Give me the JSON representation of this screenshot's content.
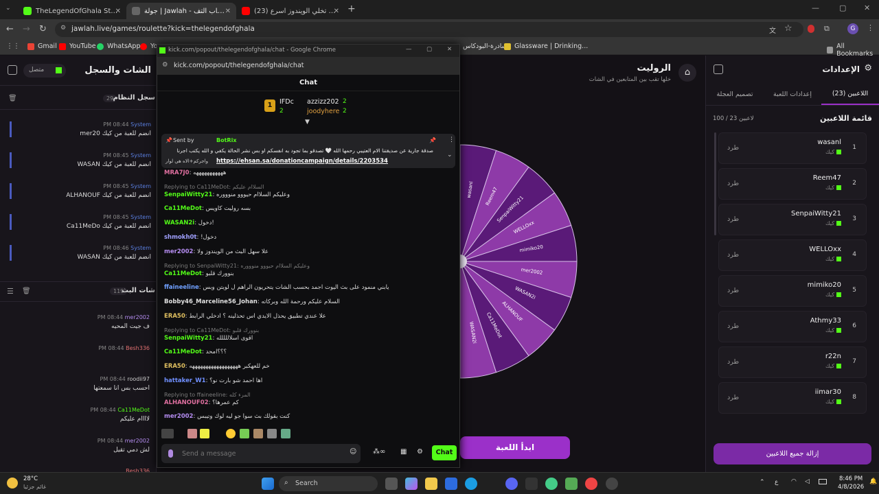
{
  "tabs": [
    {
      "title": "TheLegendOfGhala Stream - Ki",
      "active": false,
      "color": "#53fc18"
    },
    {
      "title": "جولة | Jawlah - منصة الألعاب التف",
      "active": true,
      "color": "#2b2b2b"
    },
    {
      "title": "(23) كيف تخلي الويندوز اسرع - YouTube",
      "active": false,
      "color": "#ff0000"
    }
  ],
  "address": {
    "url": "jawlah.live/games/roulette?kick=thelegendofghala"
  },
  "bookmarks": {
    "items": [
      "Gmail",
      "YouTube",
      "WhatsApp",
      "Yo",
      "سادرة-البودكاس",
      "Glassware | Drinking..."
    ],
    "all": "All Bookmarks"
  },
  "left_panel": {
    "title": "الشات والسجل",
    "status": "متصل",
    "log_title": "سجل النظام",
    "log_count": "29",
    "logs": [
      {
        "time": "PM 08:44",
        "who": "System",
        "msg": "mer20 انضم للعبة من كيك"
      },
      {
        "time": "PM 08:45",
        "who": "System",
        "msg": "WASAN انضم للعبة من كيك"
      },
      {
        "time": "PM 08:45",
        "who": "System",
        "msg": "ALHANOUF انضم للعبة من كيك"
      },
      {
        "time": "PM 08:45",
        "who": "System",
        "msg": "Ca11MeDo انضم للعبة من كيك"
      },
      {
        "time": "PM 08:46",
        "who": "System",
        "msg": "WASAN انضم للعبة من كيك"
      }
    ],
    "chat_title": "شات البث",
    "chat_count": "119",
    "chat": [
      {
        "time": "PM 08:44",
        "who": "mer2002",
        "color": "#b48cf0",
        "msg": "ف جيت المحيه"
      },
      {
        "time": "PM 08:44",
        "who": "Besh336",
        "color": "#e07070",
        "msg": ""
      },
      {
        "time": "PM 08:44",
        "who": "roodii97",
        "color": "#cccccc",
        "msg": "احسب بس انا سمعتها"
      },
      {
        "time": "PM 08:44",
        "who": "Ca11MeDot",
        "color": "#53fc18",
        "msg": "لاااام عليكم"
      },
      {
        "time": "PM 08:44",
        "who": "mer2002",
        "color": "#b48cf0",
        "msg": "لش دمي تقيل"
      },
      {
        "time": "",
        "who": "Besh336",
        "color": "#e07070",
        "msg": ""
      }
    ]
  },
  "game": {
    "title": "الروليت",
    "subtitle": "خلها تقب بين المتابعين في الشات",
    "start_label": "ابدأ اللعبة"
  },
  "wheel": {
    "slices": [
      "wasanl",
      "Reem47",
      "SenpaiWitty21",
      "WELLOxx",
      "mimiko20",
      "mer2002",
      "WASAN2i",
      "ALHANOUF",
      "Ca11MeDot",
      "WASAN2i"
    ]
  },
  "settings": {
    "title": "الإعدادات",
    "tabs": [
      "اللاعبين (23)",
      "إعدادات اللعبة",
      "تصميم العجلة"
    ],
    "list_title": "قائمة اللاعبين",
    "capacity": "100 / 23 لاعبين",
    "platform": "كيك",
    "kick_label": "طرد",
    "players": [
      {
        "n": "1",
        "name": "wasanl"
      },
      {
        "n": "2",
        "name": "Reem47"
      },
      {
        "n": "3",
        "name": "SenpaiWitty21"
      },
      {
        "n": "4",
        "name": "WELLOxx"
      },
      {
        "n": "5",
        "name": "mimiko20"
      },
      {
        "n": "6",
        "name": "Athmy33"
      },
      {
        "n": "7",
        "name": "r22n"
      },
      {
        "n": "8",
        "name": "iimar30"
      }
    ],
    "remove_all": "إزالة جميع اللاعبين"
  },
  "popup": {
    "window_title": "kick.com/popout/thelegendofghala/chat - Google Chrome",
    "url": "kick.com/popout/thelegendofghala/chat",
    "header": "Chat",
    "gift_top": {
      "user1": "azzizz202",
      "user2": "joodyhere",
      "n1": "2",
      "n2": "2",
      "me": "IFDc",
      "me_n": "2"
    },
    "pinned": {
      "sent_by": "Sent by",
      "bot": "BotRix",
      "text1": "صدقة جارية عن صديقتنا الام العتيبي رحمها الله 🤍 تصدقو بما تجود به انفسكم او بس نشر الحالة يكفي و الله يكتب اجرنا",
      "text2": "واجركم+الاه هي لوار",
      "link": "https://ehsan.sa/donationcampaign/details/2203534"
    },
    "messages": [
      {
        "u": "MRA7J0",
        "c": "#e070a0",
        "t": "هههههههههههه",
        "r": ""
      },
      {
        "u": "SenpaiWitty21",
        "c": "#53fc18",
        "t": "وعليكم السلاام حيووو منوووره",
        "r": "Replying to Ca11MeDot: السلاام عليكم"
      },
      {
        "u": "Ca11MeDot",
        "c": "#53fc18",
        "t": "بسه روليت كاويس",
        "r": ""
      },
      {
        "u": "WASAN2i",
        "c": "#53fc18",
        "t": "دخول!",
        "r": ""
      },
      {
        "u": "shmokh0t",
        "c": "#a0a0ff",
        "t": "!دخول",
        "r": ""
      },
      {
        "u": "mer2002",
        "c": "#b48cf0",
        "t": "علا سهل البث من الويندوز ولا",
        "r": ""
      },
      {
        "u": "Ca11MeDot",
        "c": "#53fc18",
        "t": "بنوورك قلبو",
        "r": "Replying to SenpaiWitty21: وعليكم السلاام حيووو منوووره"
      },
      {
        "u": "ffaineeline",
        "c": "#70a0ff",
        "t": "يابني منمود على بث اليوت اجمد بحسب الشات يتحريون الراهم ل لوبتن وبس",
        "r": ""
      },
      {
        "u": "Bobby46_Marceline56_Johan",
        "c": "#e0e0e0",
        "t": "السلام عليكم ورحمة الله وبركاته",
        "r": ""
      },
      {
        "u": "ERA50",
        "c": "#e0c060",
        "t": "علا عندي تطبيق يحذل الايدي اس تحذلينه ؟ ادخلي الرابط",
        "r": ""
      },
      {
        "u": "SenpaiWitty21",
        "c": "#53fc18",
        "t": "اقوى اسلاللللله",
        "r": "Replying to Ca11MeDot: بنوورك قلبو"
      },
      {
        "u": "Ca11MeDot",
        "c": "#53fc18",
        "t": "؟؟؟امحد",
        "r": ""
      },
      {
        "u": "ERA50",
        "c": "#e0c060",
        "t": "خم للعهكبر ههههههههههههههههههه",
        "r": ""
      },
      {
        "u": "hattaker_W1",
        "c": "#7090ff",
        "t": "اها احمد شو بارت نو؟",
        "r": ""
      },
      {
        "u": "ALHANOUF02",
        "c": "#e070a0",
        "t": "كم عمرها؟",
        "r": "Replying to ffaineeline: المرء كله"
      },
      {
        "u": "mer2002",
        "c": "#b48cf0",
        "t": "كنت بقولك بث سوآ جو ليه لوك وتيبس",
        "r": ""
      }
    ],
    "input_placeholder": "Send a message",
    "send": "Chat"
  },
  "system": {
    "temp": "28°C",
    "weather": "غائم جزئيا",
    "search": "Search",
    "time": "8:46 PM",
    "date": "4/8/2026"
  },
  "colors": {
    "accent": "#9b30c9",
    "kick": "#53fc18",
    "wheel_dark": "#5a1a78",
    "wheel_light": "#8e3aa8"
  }
}
